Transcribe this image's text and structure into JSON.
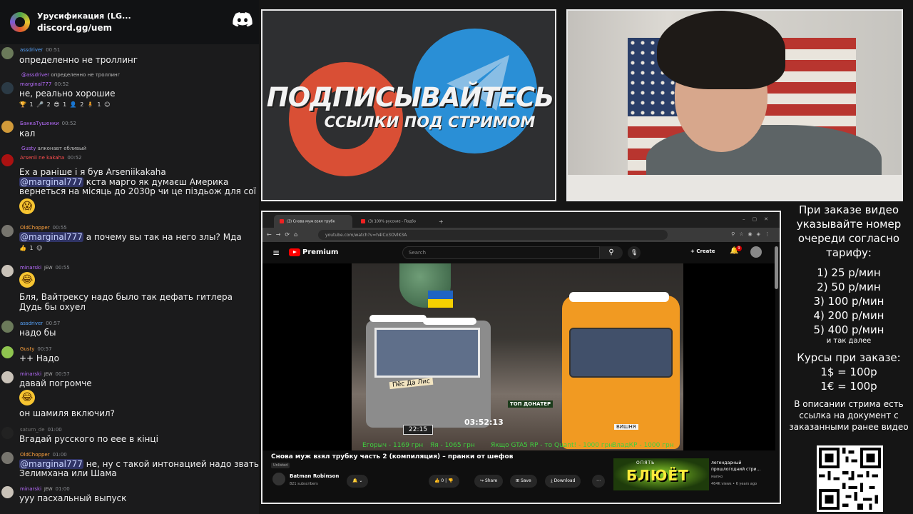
{
  "server": {
    "name": "Урусификация (LG...",
    "link": "discord.gg/uem"
  },
  "chat": [
    {
      "user": "assdriver",
      "time": "00:51",
      "text": "определенно не троллинг"
    },
    {
      "reply_user": "@assdriver",
      "reply_text": "определенно не троллинг",
      "user": "marginal777",
      "time": "00:52",
      "text": "не, реально хорошие",
      "reactions": "🏆 1   🎤 2   😎 1   👤 2   🧍 1   ☺"
    },
    {
      "user": "БанкаТушенки",
      "time": "00:52",
      "text": "кал"
    },
    {
      "reply_user": "Gusty",
      "reply_text": "алконавт ебливый",
      "user": "Arsenii ne kakaha",
      "time": "00:52",
      "text1": "Ех а раніше і я був Arseniikakaha",
      "mention": "@marginal777",
      "text2": " кста марго як думаєш Америка",
      "text3": "вернеться на місяць до 2030р чи це піздьож для сої ?"
    },
    {
      "user": "OldChopper",
      "time": "00:55",
      "mention": "@marginal777",
      "text": " а почему вы так на него злы? Мда",
      "reactions": "👍 1   ☺"
    },
    {
      "user": "minarski",
      "badge": "JEW",
      "time": "00:55",
      "text1": "Бля, Вайтрексу надо было так дефать гитлера",
      "text2": "Дудь бы охуел"
    },
    {
      "user": "assdriver",
      "time": "00:57",
      "text": "надо бы"
    },
    {
      "user": "Gusty",
      "time": "00:57",
      "text": "++ Надо"
    },
    {
      "user": "minarski",
      "badge": "JEW",
      "time": "00:57",
      "text1": "давай погромче",
      "text2": "он шамиля включил?"
    },
    {
      "user": "saturn_de",
      "time": "01:00",
      "text": "Вгадай русского по еее в кінці"
    },
    {
      "user": "OldChopper",
      "time": "01:00",
      "mention": "@marginal777",
      "text1": " не, ну с такой интонацией надо звать",
      "text2": "Зелимхана или Шама"
    },
    {
      "user": "minarski",
      "badge": "JEW",
      "time": "01:00",
      "text": "ууу пасхальный выпуск"
    }
  ],
  "promo": {
    "headline": "ПОДПИСЫВАЙТЕСЬ",
    "subline": "ССЫЛКИ ПОД СТРИМОМ"
  },
  "browser": {
    "tabs": [
      "(3) Снова муж взял трубк",
      "(3) 100% русские - Подбо"
    ],
    "url": "youtube.com/watch?v=h4lCx3OVlK3A",
    "yt_logo": "Premium",
    "search_placeholder": "Search",
    "create": "Create",
    "notif_count": "9",
    "video": {
      "sign1": "Пёс Да Лис",
      "timer_small": "22:15",
      "timer_big": "03:52:13",
      "top_donater": "ТОП ДОНАТЕР",
      "plate": "ВИШНЯ",
      "donors": [
        "Егорыч - 1169 грн",
        "Яя - 1065 грн",
        "Якщо GTA5 RP - то Quant! - 1000 грн",
        "ВладКР - 1000 грн"
      ]
    },
    "title": "Снова муж взял трубку часть 2 (компиляция) – пранки от шефов",
    "unlisted": "Unlisted",
    "channel": "Batman Robinson",
    "subs": "821 subscribers",
    "likes": "0",
    "share": "Share",
    "save": "Save",
    "download": "Download",
    "rec_thumb_text": "БЛЮЁТ",
    "rec_thumb_top": "ОПЯТЬ",
    "rec_title": "легендарный прошлогодний стри...",
    "rec_channel": "мапко",
    "rec_meta": "464K views • 6 years ago"
  },
  "info": {
    "line1": "При заказе видео указывайте номер очереди согласно тарифу:",
    "tariffs": [
      "1) 25 р/мин",
      "2) 50 р/мин",
      "3) 100 р/мин",
      "4) 200 р/мин",
      "5) 400 р/мин"
    ],
    "etc": "и так далее",
    "rates_title": "Курсы при заказе:",
    "rates": [
      "1$ = 100р",
      "1€ = 100р"
    ],
    "desc": "В описании стрима есть ссылка на документ с заказанными ранее видео"
  }
}
